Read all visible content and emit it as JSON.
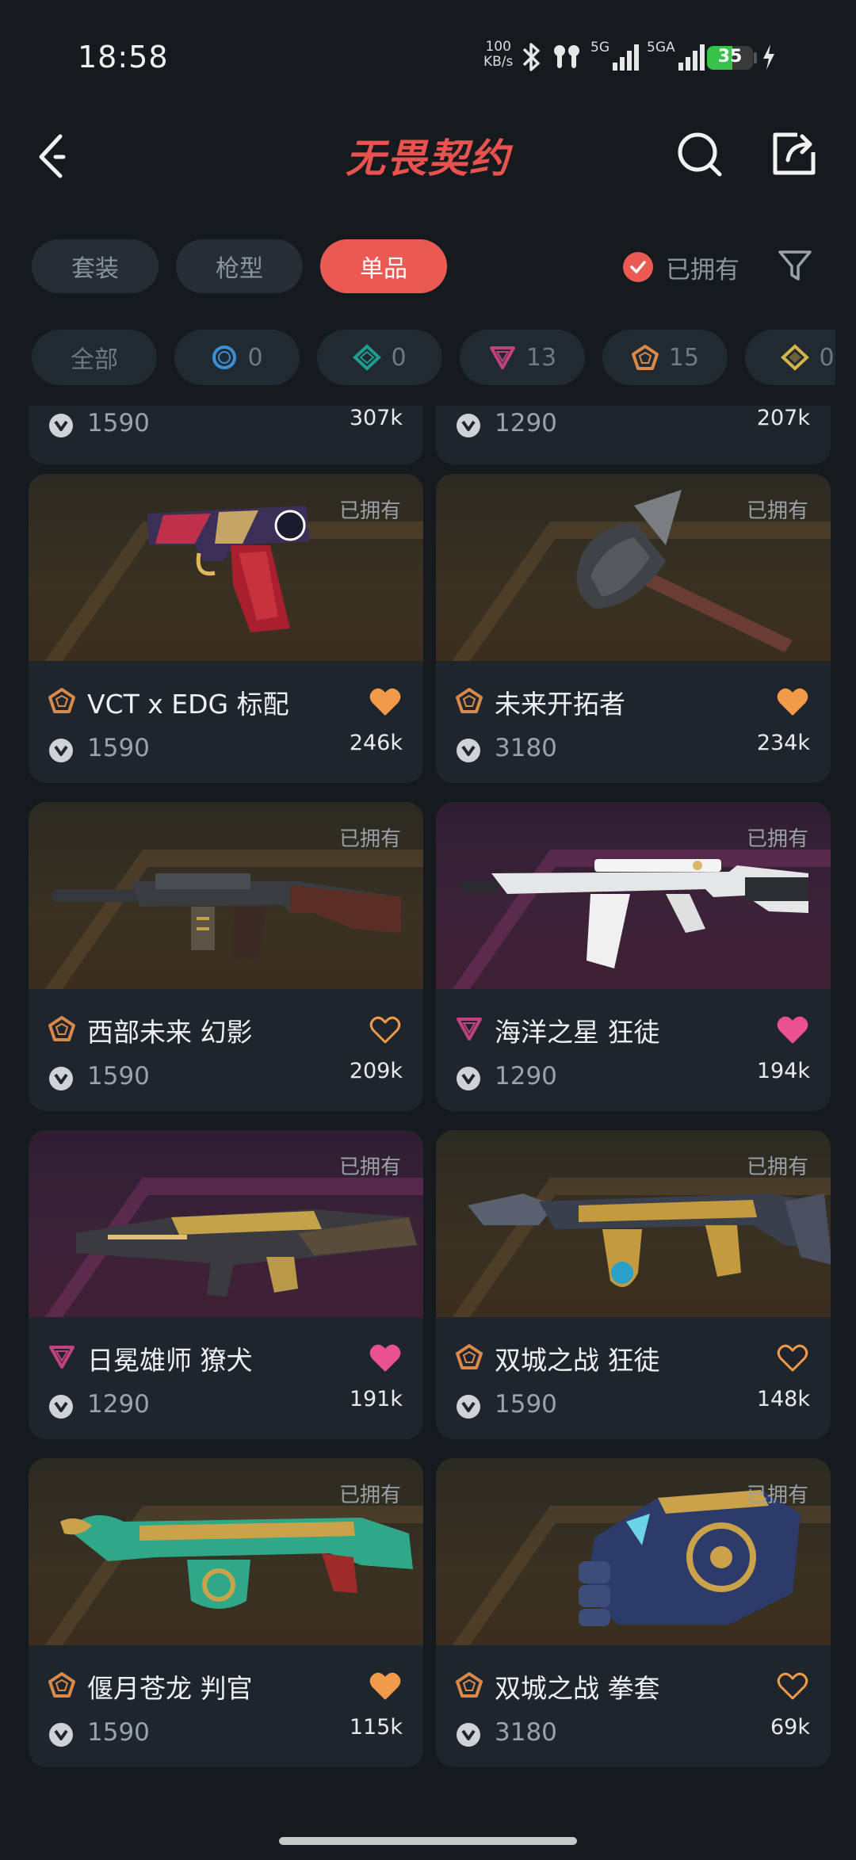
{
  "status_bar": {
    "time": "18:58",
    "net_speed_value": "100",
    "net_speed_unit": "KB/s",
    "signal1_label": "5G",
    "signal2_label": "5GA",
    "battery": "35",
    "battery_level": 0.35,
    "battery_color": "#37c24a"
  },
  "header": {
    "title": "无畏契约",
    "title_color": "#e8534f",
    "back_icon": "back-arrow-icon",
    "search_icon": "search-icon",
    "share_icon": "share-icon"
  },
  "tabs": [
    {
      "label": "套装",
      "active": false
    },
    {
      "label": "枪型",
      "active": false
    },
    {
      "label": "单品",
      "active": true
    }
  ],
  "owned_filter": {
    "label": "已拥有",
    "checked": true,
    "accent": "#ea5a52"
  },
  "rarity_chips": [
    {
      "label": "全部"
    },
    {
      "tier": "select",
      "count": "0",
      "color": "#3a8fd6"
    },
    {
      "tier": "deluxe",
      "count": "0",
      "color": "#1f9c8f"
    },
    {
      "tier": "premium",
      "count": "13",
      "color": "#c2417f"
    },
    {
      "tier": "exclusive",
      "count": "15",
      "color": "#d98a4a"
    },
    {
      "tier": "ultra",
      "count": "0",
      "color": "#d6b44a"
    }
  ],
  "partial_row": [
    {
      "price": "1590",
      "likes": "307k"
    },
    {
      "price": "1290",
      "likes": "207k"
    }
  ],
  "skins": [
    {
      "name": "VCT x EDG 标配",
      "price": "1590",
      "likes": "246k",
      "owned_label": "已拥有",
      "tier": "exclusive",
      "favorited": true,
      "heart_color": "#f09a4a",
      "theme": "gold",
      "weapon": "pistol"
    },
    {
      "name": "未来开拓者",
      "price": "3180",
      "likes": "234k",
      "owned_label": "已拥有",
      "tier": "exclusive",
      "favorited": true,
      "heart_color": "#f09a4a",
      "theme": "gold",
      "weapon": "axe"
    },
    {
      "name": "西部未来 幻影",
      "price": "1590",
      "likes": "209k",
      "owned_label": "已拥有",
      "tier": "exclusive",
      "favorited": false,
      "heart_color": "#f09a4a",
      "theme": "gold",
      "weapon": "rifle"
    },
    {
      "name": "海洋之星 狂徒",
      "price": "1290",
      "likes": "194k",
      "owned_label": "已拥有",
      "tier": "premium",
      "favorited": true,
      "heart_color": "#e9508e",
      "theme": "purple",
      "weapon": "vandal-white"
    },
    {
      "name": "日冕雄师 獠犬",
      "price": "1290",
      "likes": "191k",
      "owned_label": "已拥有",
      "tier": "premium",
      "favorited": true,
      "heart_color": "#e9508e",
      "theme": "purple",
      "weapon": "bulldog"
    },
    {
      "name": "双城之战 狂徒",
      "price": "1590",
      "likes": "148k",
      "owned_label": "已拥有",
      "tier": "exclusive",
      "favorited": false,
      "heart_color": "#f09a4a",
      "theme": "gold",
      "weapon": "vandal-arcane"
    },
    {
      "name": "偃月苍龙 判官",
      "price": "1590",
      "likes": "115k",
      "owned_label": "已拥有",
      "tier": "exclusive",
      "favorited": true,
      "heart_color": "#f09a4a",
      "theme": "gold",
      "weapon": "judge"
    },
    {
      "name": "双城之战 拳套",
      "price": "3180",
      "likes": "69k",
      "owned_label": "已拥有",
      "tier": "exclusive",
      "favorited": false,
      "heart_color": "#f09a4a",
      "theme": "gold",
      "weapon": "gauntlet"
    }
  ]
}
